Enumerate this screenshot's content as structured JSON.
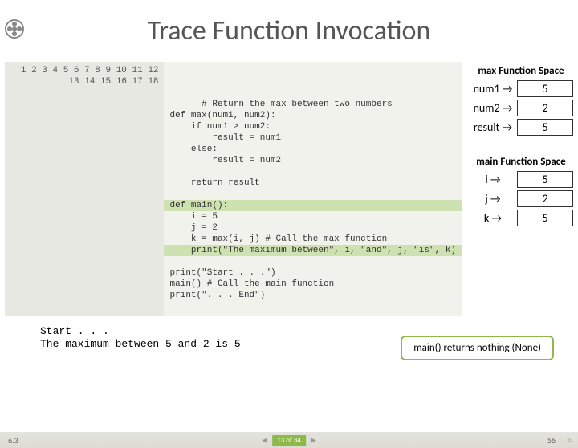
{
  "title": "Trace Function Invocation",
  "code": {
    "linenumbers": "1\n2\n3\n4\n5\n6\n7\n8\n9\n10\n11\n12\n13\n14\n15\n16\n17\n18",
    "text": "# Return the max between two numbers\ndef max(num1, num2):\n    if num1 > num2:\n        result = num1\n    else:\n        result = num2\n\n    return result\n\ndef main():\n    i = 5\n    j = 2\n    k = max(i, j) # Call the max function\n    print(\"The maximum between\", i, \"and\", j, \"is\", k)\n\nprint(\"Start . . .\")\nmain() # Call the main function\nprint(\". . . End\")"
  },
  "max_space": {
    "title": "max Function Space",
    "rows": [
      {
        "name": "num1 →",
        "val": "5"
      },
      {
        "name": "num2 →",
        "val": "2"
      },
      {
        "name": "result →",
        "val": "5"
      }
    ]
  },
  "main_space": {
    "title": "main Function Space",
    "rows": [
      {
        "name": "i →",
        "val": "5"
      },
      {
        "name": "j →",
        "val": "2"
      },
      {
        "name": "k →",
        "val": "5"
      }
    ]
  },
  "output": "Start . . .\nThe maximum between 5 and 2 is 5",
  "callout": {
    "pre": "main() ",
    "mid": "returns nothing (",
    "u": "None",
    "post": ")"
  },
  "footer": {
    "section": "6.3",
    "page_label": "13 of 34",
    "page_num": "56"
  }
}
